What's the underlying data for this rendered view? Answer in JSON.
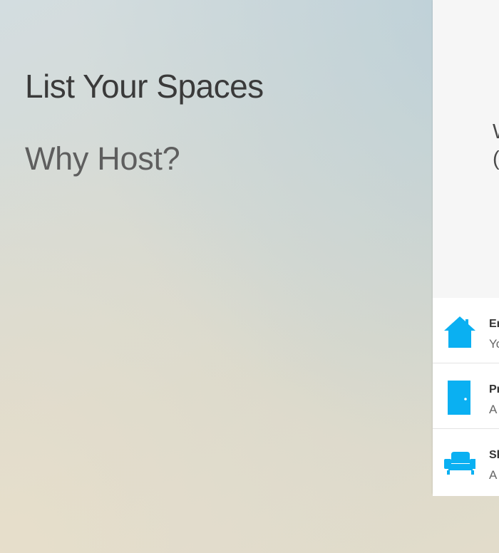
{
  "hero": {
    "title": "List Your Spaces",
    "why_host_link": "Why Host?"
  },
  "panel": {
    "heading_lines": [
      "W",
      "("
    ]
  },
  "space_types": [
    {
      "icon": "house-icon",
      "title": "Er",
      "description": "Yo"
    },
    {
      "icon": "door-icon",
      "title": "Pr",
      "description": "A"
    },
    {
      "icon": "couch-icon",
      "title": "Sh",
      "description": "A"
    }
  ],
  "colors": {
    "accent_icon": "#0ab0f2",
    "panel_background": "#f6f6f6",
    "list_background": "#ffffff",
    "title_text": "#3a3a3a"
  }
}
